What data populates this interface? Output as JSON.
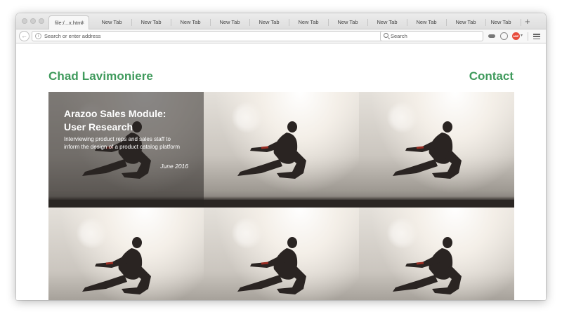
{
  "browser": {
    "tabs": [
      {
        "label": "file:/...x.html",
        "active": true
      },
      {
        "label": "New Tab"
      },
      {
        "label": "New Tab"
      },
      {
        "label": "New Tab"
      },
      {
        "label": "New Tab"
      },
      {
        "label": "New Tab"
      },
      {
        "label": "New Tab"
      },
      {
        "label": "New Tab"
      },
      {
        "label": "New Tab"
      },
      {
        "label": "New Tab"
      },
      {
        "label": "New Tab"
      },
      {
        "label": "New Tab"
      },
      {
        "label": "New Tab"
      }
    ],
    "tab_close_glyph": "×",
    "new_tab_glyph": "+",
    "back_glyph": "←",
    "info_glyph": "i",
    "address_placeholder": "Search or enter address",
    "address_value": "",
    "reload_glyph": "↻",
    "search_placeholder": "Search",
    "adblock_label": "ABP",
    "dropdown_glyph": "▾"
  },
  "site": {
    "name": "Chad Lavimoniere",
    "contact_label": "Contact",
    "accent_color": "#3f9a5c"
  },
  "projects": [
    {
      "title": "Arazoo Sales Module: User Research",
      "description": "Interviewing product reps and sales staff to inform the design of a product catalog platform",
      "date": "June 2016"
    }
  ],
  "icons": {
    "back": "back-arrow-icon",
    "info": "info-icon",
    "reload": "reload-icon",
    "search": "search-icon",
    "private": "mask-icon",
    "sync": "sync-icon",
    "adblock": "adblock-icon",
    "menu": "hamburger-menu-icon"
  }
}
